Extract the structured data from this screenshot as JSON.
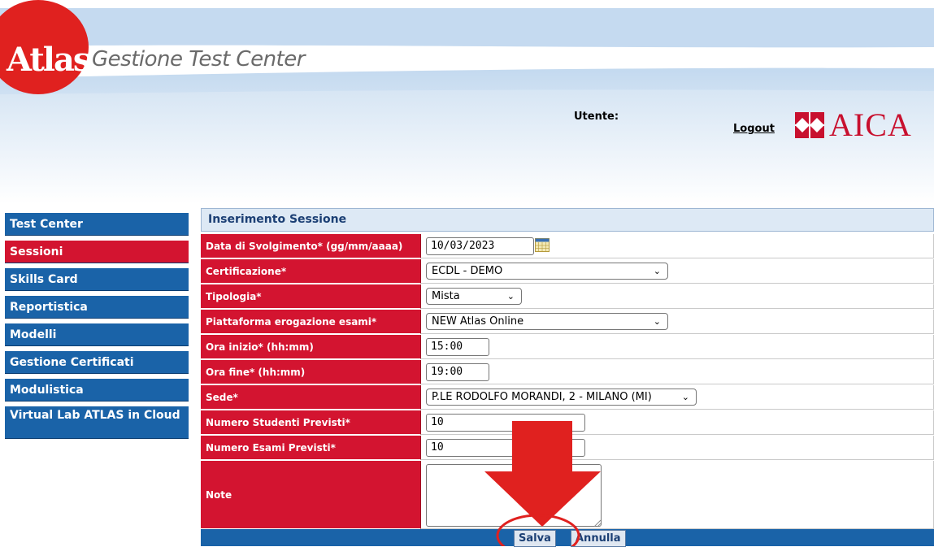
{
  "header": {
    "logo_text": "Atlas",
    "app_title": "Gestione Test Center",
    "user_label": "Utente:",
    "logout_label": "Logout",
    "aica_text": "AICA"
  },
  "sidebar": {
    "items": [
      {
        "label": "Test Center"
      },
      {
        "label": "Sessioni"
      },
      {
        "label": "Skills Card"
      },
      {
        "label": "Reportistica"
      },
      {
        "label": "Modelli"
      },
      {
        "label": "Gestione Certificati"
      },
      {
        "label": "Modulistica"
      },
      {
        "label": "Virtual Lab ATLAS in Cloud"
      }
    ]
  },
  "form": {
    "title": "Inserimento Sessione",
    "fields": [
      {
        "label": "Data di Svolgimento* (gg/mm/aaaa)",
        "value": "10/03/2023"
      },
      {
        "label": "Certificazione*",
        "value": "ECDL - DEMO"
      },
      {
        "label": "Tipologia*",
        "value": "Mista"
      },
      {
        "label": "Piattaforma erogazione esami*",
        "value": "NEW Atlas Online"
      },
      {
        "label": "Ora inizio* (hh:mm)",
        "value": "15:00"
      },
      {
        "label": "Ora fine* (hh:mm)",
        "value": "19:00"
      },
      {
        "label": "Sede*",
        "value": "P.LE RODOLFO MORANDI, 2 - MILANO (MI)"
      },
      {
        "label": "Numero Studenti Previsti*",
        "value": "10"
      },
      {
        "label": "Numero Esami Previsti*",
        "value": "10"
      },
      {
        "label": "Note",
        "value": ""
      }
    ],
    "save_label": "Salva",
    "cancel_label": "Annulla"
  },
  "colors": {
    "sidebar_blue": "#1a63a8",
    "active_red": "#d31430",
    "label_red": "#d31430",
    "header_blue": "#dde9f5",
    "annotation_red": "#e0211f"
  },
  "icons": {
    "calendar": "calendar-icon",
    "select_arrow": "chevron-down-icon",
    "resize": "resize-grip-icon",
    "aica_logo": "aica-logo-icon",
    "atlas_logo": "atlas-logo"
  }
}
